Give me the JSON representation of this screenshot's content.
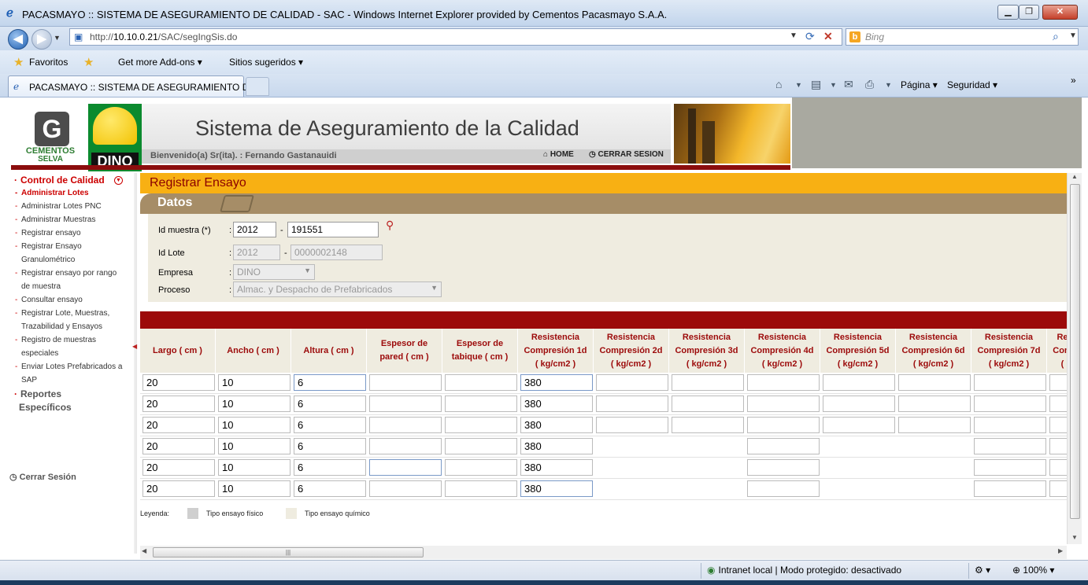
{
  "window": {
    "title": "PACASMAYO :: SISTEMA DE ASEGURAMIENTO DE CALIDAD - SAC - Windows Internet Explorer provided by Cementos Pacasmayo S.A.A.",
    "min": "▁",
    "max": "❐",
    "close": "✕"
  },
  "address": {
    "url_prefix": "http://",
    "url_host": "10.10.0.21",
    "url_path": "/SAC/segIngSis.do",
    "search_placeholder": "Bing"
  },
  "favorites": {
    "favorites_label": "Favoritos",
    "addons_label": "Get more Add-ons ▾",
    "suggested_label": "Sitios sugeridos ▾"
  },
  "tab": {
    "label": "PACASMAYO :: SISTEMA DE ASEGURAMIENTO D..."
  },
  "commands": {
    "page_label": "Página ▾",
    "security_label": "Seguridad ▾",
    "chevron": "»"
  },
  "header": {
    "logo_line1": "CEMENTOS",
    "logo_line2": "SELVA",
    "brand": "DINO",
    "title": "Sistema de Aseguramiento de la Calidad",
    "welcome": "Bienvenido(a) Sr(ita). : Fernando Gastanauidi",
    "home": "HOME",
    "logout": "CERRAR SESION"
  },
  "sidebar": {
    "section1": "Control de Calidad",
    "links": [
      "Administrar Lotes",
      "Administrar Lotes PNC",
      "Administrar Muestras",
      "Registrar ensayo",
      "Registrar Ensayo",
      "Granulométrico",
      "Registrar ensayo por rango",
      "de muestra",
      "Consultar ensayo",
      "Registrar Lote, Muestras,",
      "Trazabilidad y Ensayos",
      "Registro de muestras",
      "especiales",
      "Enviar Lotes Prefabricados a",
      "SAP"
    ],
    "section2_line1": "Reportes",
    "section2_line2": "Específicos",
    "logout": "Cerrar Sesión"
  },
  "form": {
    "page_title": "Registrar Ensayo",
    "section": "Datos",
    "id_muestra_label": "Id muestra (*)",
    "id_muestra_year": "2012",
    "id_muestra_num": "191551",
    "id_lote_label": "Id Lote",
    "id_lote_year": "2012",
    "id_lote_num": "0000002148",
    "empresa_label": "Empresa",
    "empresa_value": "DINO",
    "proceso_label": "Proceso",
    "proceso_value": "Almac. y Despacho de Prefabricados",
    "colon": ":",
    "dash": "-"
  },
  "grid": {
    "headers": [
      "Largo ( cm )",
      "Ancho ( cm )",
      "Altura ( cm )",
      "Espesor de\npared ( cm )",
      "Espesor de\ntabique ( cm )",
      "Resistencia\nCompresión 1d\n( kg/cm2 )",
      "Resistencia\nCompresión 2d\n( kg/cm2 )",
      "Resistencia\nCompresión 3d\n( kg/cm2 )",
      "Resistencia\nCompresión 4d\n( kg/cm2 )",
      "Resistencia\nCompresión 5d\n( kg/cm2 )",
      "Resistencia\nCompresión 6d\n( kg/cm2 )",
      "Resistencia\nCompresión 7d\n( kg/cm2 )",
      "Re\nCom\n("
    ],
    "rows": [
      [
        "20",
        "10",
        "6",
        "",
        "",
        "380",
        "",
        "",
        "",
        "",
        "",
        "",
        ""
      ],
      [
        "20",
        "10",
        "6",
        "",
        "",
        "380",
        "",
        "",
        "",
        "",
        "",
        "",
        ""
      ],
      [
        "20",
        "10",
        "6",
        "",
        "",
        "380",
        "",
        "",
        "",
        "",
        "",
        "",
        ""
      ],
      [
        "20",
        "10",
        "6",
        "",
        "",
        "380",
        "",
        "",
        "",
        "",
        "",
        "",
        ""
      ],
      [
        "20",
        "10",
        "6",
        "",
        "",
        "380",
        "",
        "",
        "",
        "",
        "",
        "",
        ""
      ],
      [
        "20",
        "10",
        "6",
        "",
        "",
        "380",
        "",
        "",
        "",
        "",
        "",
        "",
        ""
      ]
    ]
  },
  "legend": {
    "title": "Leyenda:",
    "physical": "Tipo ensayo físico",
    "chemical": "Tipo ensayo químico",
    "physical_color": "#cfcfcf",
    "chemical_color": "#efece0"
  },
  "status": {
    "zone": "Intranet local | Modo protegido: desactivado",
    "zoom": "100%"
  },
  "colors": {
    "accent_orange": "#f8b013",
    "dark_red": "#9c0a0a",
    "tan": "#a68d67"
  }
}
